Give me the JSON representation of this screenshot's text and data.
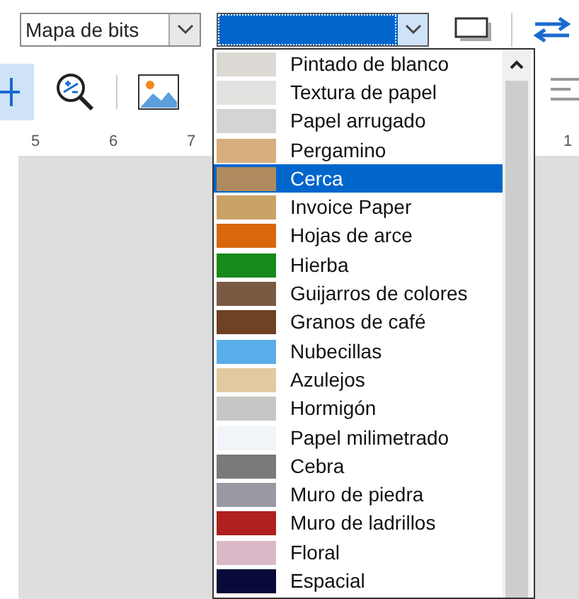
{
  "toolbar": {
    "format_combo": {
      "value": "Mapa de bits"
    },
    "fill_combo": {
      "expanded": true
    }
  },
  "ruler": {
    "labels": [
      "5",
      "6",
      "7",
      "1"
    ]
  },
  "texture_list": {
    "items": [
      {
        "label": "Pintado de blanco",
        "color": "#dcd9d4",
        "selected": false
      },
      {
        "label": "Textura de papel",
        "color": "#e2e2e0",
        "selected": false
      },
      {
        "label": "Papel arrugado",
        "color": "#d4d4d2",
        "selected": false
      },
      {
        "label": "Pergamino",
        "color": "#d7ae7c",
        "selected": false
      },
      {
        "label": "Cerca",
        "color": "#b08a5e",
        "selected": true
      },
      {
        "label": "Invoice Paper",
        "color": "#caa265",
        "selected": false
      },
      {
        "label": "Hojas de arce",
        "color": "#d8670e",
        "selected": false
      },
      {
        "label": "Hierba",
        "color": "#168a1a",
        "selected": false
      },
      {
        "label": "Guijarros de colores",
        "color": "#7b5a44",
        "selected": false
      },
      {
        "label": "Granos de café",
        "color": "#6e4222",
        "selected": false
      },
      {
        "label": "Nubecillas",
        "color": "#5aaeea",
        "selected": false
      },
      {
        "label": "Azulejos",
        "color": "#e3c9a0",
        "selected": false
      },
      {
        "label": "Hormigón",
        "color": "#c9c7c5",
        "selected": false
      },
      {
        "label": "Papel milimetrado",
        "color": "#f1f4f8",
        "selected": false
      },
      {
        "label": "Cebra",
        "color": "#7a7a7a",
        "selected": false
      },
      {
        "label": "Muro de piedra",
        "color": "#9a99a3",
        "selected": false
      },
      {
        "label": "Muro de ladrillos",
        "color": "#b02020",
        "selected": false
      },
      {
        "label": "Floral",
        "color": "#d9b8c8",
        "selected": false
      },
      {
        "label": "Espacial",
        "color": "#0a0a3a",
        "selected": false
      }
    ]
  }
}
